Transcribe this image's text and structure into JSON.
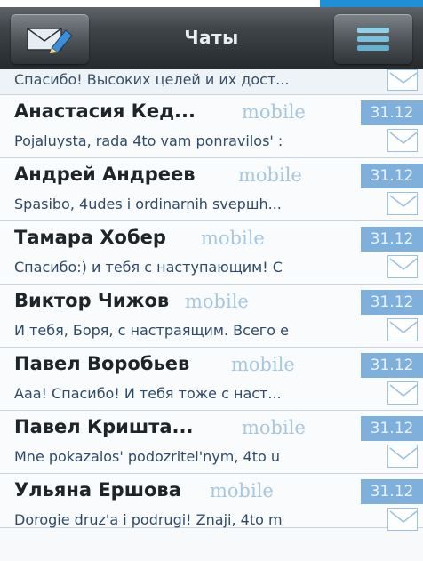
{
  "header": {
    "title": "Чаты",
    "left_icon": "compose-icon",
    "right_icon": "menu-icon"
  },
  "colors": {
    "accent": "#1f8fd6",
    "status": "#a7c7e0",
    "date_badge": "#7fb0dc",
    "preview_text": "#2f4a6a"
  },
  "chats": [
    {
      "name": "",
      "status": "",
      "date": "",
      "preview": "Спасибо! Высоких целей и их дост..."
    },
    {
      "name": "Анастасия Кед...",
      "status": "mobile",
      "date": "31.12",
      "preview": "Pojaluysta, rada 4to vam ponravilos' :"
    },
    {
      "name": "Андрей Андреев",
      "status": "mobile",
      "date": "31.12",
      "preview": "Spasibo, 4udes i ordinarnih svершh..."
    },
    {
      "name": "Тамара Хобер",
      "status": "mobile",
      "date": "31.12",
      "preview": "Спасибо:) и тебя с наступающим! С"
    },
    {
      "name": "Виктор Чижов",
      "status": "mobile",
      "date": "31.12",
      "preview": "И тебя, Боря, с настраящим. Всего е"
    },
    {
      "name": "Павел Воробьев",
      "status": "mobile",
      "date": "31.12",
      "preview": "Ааа! Спасибо! И тебя тоже с наст..."
    },
    {
      "name": "Павел Кришта...",
      "status": "mobile",
      "date": "31.12",
      "preview": "Mne pokazalos' podozritel'nym, 4to u"
    },
    {
      "name": "Ульяна Ершова",
      "status": "mobile",
      "date": "31.12",
      "preview": "Dorogie druz'a i podrugi! Znaji, 4to m"
    }
  ]
}
